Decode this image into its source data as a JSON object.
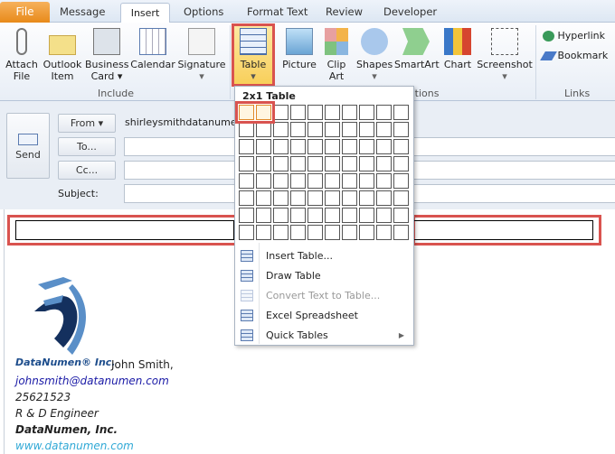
{
  "tabs": {
    "file": "File",
    "items": [
      "Message",
      "Insert",
      "Options",
      "Format Text",
      "Review",
      "Developer"
    ],
    "selected": "Insert"
  },
  "ribbon": {
    "include": {
      "label": "Include",
      "buttons": [
        {
          "label": "Attach",
          "label2": "File"
        },
        {
          "label": "Outlook",
          "label2": "Item"
        },
        {
          "label": "Business",
          "label2": "Card ▾"
        },
        {
          "label": "Calendar",
          "label2": ""
        },
        {
          "label": "Signature",
          "label2": "▾"
        }
      ]
    },
    "illustrations": {
      "label": "Illustrations",
      "buttons": [
        {
          "label": "Table",
          "label2": "▾"
        },
        {
          "label": "Picture",
          "label2": ""
        },
        {
          "label": "Clip",
          "label2": "Art"
        },
        {
          "label": "Shapes",
          "label2": "▾"
        },
        {
          "label": "SmartArt",
          "label2": ""
        },
        {
          "label": "Chart",
          "label2": ""
        },
        {
          "label": "Screenshot",
          "label2": "▾"
        }
      ]
    },
    "links": {
      "label": "Links",
      "buttons": [
        "Hyperlink",
        "Bookmark"
      ]
    }
  },
  "table_dropdown": {
    "header": "2x1 Table",
    "cols": 10,
    "rows": 8,
    "selected_cols": 2,
    "selected_rows": 1,
    "menu": [
      {
        "label": "Insert Table...",
        "enabled": true
      },
      {
        "label": "Draw Table",
        "enabled": true
      },
      {
        "label": "Convert Text to Table...",
        "enabled": false
      },
      {
        "label": "Excel Spreadsheet",
        "enabled": true
      },
      {
        "label": "Quick Tables",
        "enabled": true,
        "submenu": true
      }
    ]
  },
  "compose": {
    "send": "Send",
    "from_button": "From ▾",
    "from_value": "shirleysmithdatanumen",
    "to_button": "To...",
    "cc_button": "Cc...",
    "subject_label": "Subject:",
    "to_value": "",
    "cc_value": "",
    "subject_value": ""
  },
  "signature": {
    "logo_text": "DataNumen® Inc.",
    "name": "John Smith,",
    "email": "johnsmith@datanumen.com",
    "phone": "25621523",
    "title": "R & D Engineer",
    "company": "DataNumen, Inc.",
    "website": "www.datanumen.com"
  },
  "colors": {
    "highlight_red": "#d9534f",
    "file_tab": "#e88a1a",
    "link_blue": "#1a1aa6",
    "website": "#31a9d6"
  }
}
